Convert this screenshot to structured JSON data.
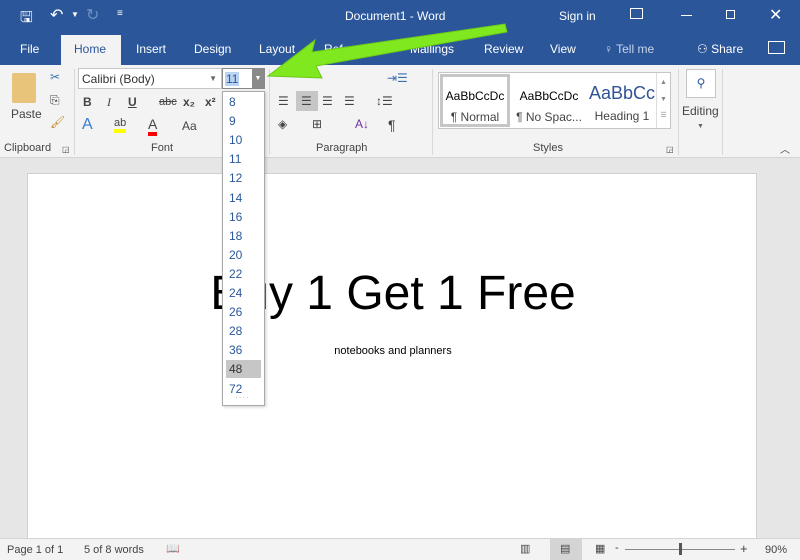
{
  "titlebar": {
    "title": "Document1  -  Word",
    "sign_in": "Sign in",
    "icons": [
      "save-icon",
      "undo-icon",
      "redo-icon",
      "customize-icon",
      "ribbon-display-icon",
      "minimize-icon",
      "restore-icon",
      "close-icon"
    ]
  },
  "tabs": [
    {
      "label": "File"
    },
    {
      "label": "Home",
      "active": true
    },
    {
      "label": "Insert"
    },
    {
      "label": "Design"
    },
    {
      "label": "Layout"
    },
    {
      "label": "References"
    },
    {
      "label": "Mailings"
    },
    {
      "label": "Review"
    },
    {
      "label": "View"
    }
  ],
  "tell_me": "Tell me",
  "share": "Share",
  "ribbon": {
    "clipboard": {
      "label": "Clipboard",
      "paste": "Paste"
    },
    "font": {
      "label": "Font",
      "font_name": "Calibri (Body)",
      "font_size": "11",
      "bold": "B",
      "italic": "I",
      "underline": "U",
      "strike": "abc",
      "sub": "x₂",
      "sup": "x²",
      "text_effects": "A",
      "highlight": "ab",
      "font_color": "A",
      "change_case": "Aa",
      "highlight_color": "#ffff00",
      "font_color_value": "#ff0000"
    },
    "paragraph": {
      "label": "Paragraph"
    },
    "styles": {
      "label": "Styles",
      "items": [
        {
          "preview": "AaBbCcDc",
          "name": "¶ Normal"
        },
        {
          "preview": "AaBbCcDc",
          "name": "¶ No Spac..."
        },
        {
          "preview": "AaBbCc",
          "name": "Heading 1"
        }
      ]
    },
    "editing": {
      "label": "Editing"
    }
  },
  "font_size_dropdown": {
    "options": [
      "8",
      "9",
      "10",
      "11",
      "12",
      "14",
      "16",
      "18",
      "20",
      "22",
      "24",
      "26",
      "28",
      "36",
      "48",
      "72"
    ],
    "highlighted": "48"
  },
  "document": {
    "heading": "Buy 1 Get 1 Free",
    "subtext": "notebooks and planners"
  },
  "status": {
    "page": "Page 1 of 1",
    "words": "5 of 8 words",
    "zoom": "90%",
    "zoom_minus": "-",
    "zoom_plus": "+"
  },
  "colors": {
    "brand": "#2b579a",
    "arrow": "#7fe81e"
  }
}
